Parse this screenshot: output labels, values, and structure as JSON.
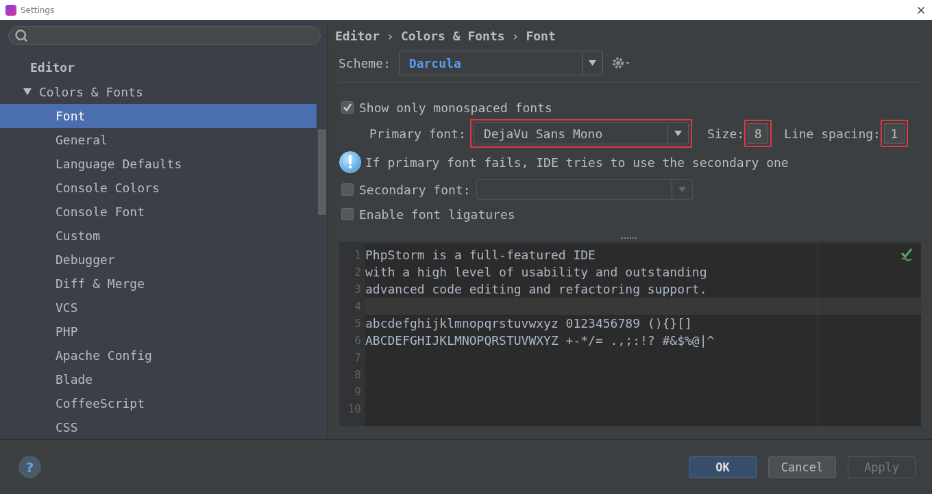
{
  "window": {
    "title": "Settings"
  },
  "sidebar": {
    "section": "Editor",
    "tree": [
      {
        "label": "Colors & Fonts",
        "expanded": true,
        "selected": false,
        "children": [
          {
            "label": "Font",
            "selected": true
          },
          {
            "label": "General",
            "selected": false
          },
          {
            "label": "Language Defaults",
            "selected": false
          },
          {
            "label": "Console Colors",
            "selected": false
          },
          {
            "label": "Console Font",
            "selected": false
          },
          {
            "label": "Custom",
            "selected": false
          },
          {
            "label": "Debugger",
            "selected": false
          },
          {
            "label": "Diff & Merge",
            "selected": false
          },
          {
            "label": "VCS",
            "selected": false
          },
          {
            "label": "PHP",
            "selected": false
          },
          {
            "label": "Apache Config",
            "selected": false
          },
          {
            "label": "Blade",
            "selected": false
          },
          {
            "label": "CoffeeScript",
            "selected": false
          },
          {
            "label": "CSS",
            "selected": false
          }
        ]
      }
    ]
  },
  "breadcrumb": [
    {
      "kind": "crumb",
      "text": "Editor"
    },
    {
      "kind": "separator",
      "text": "›"
    },
    {
      "kind": "crumb",
      "text": "Colors & Fonts"
    },
    {
      "kind": "separator",
      "text": "›"
    },
    {
      "kind": "crumb",
      "text": "Font"
    }
  ],
  "scheme": {
    "label": "Scheme:",
    "value": "Darcula"
  },
  "show_monospaced": {
    "label": "Show only monospaced fonts",
    "checked": true
  },
  "primary_font": {
    "label": "Primary font:",
    "value": "DejaVu Sans Mono",
    "highlighted": true
  },
  "size": {
    "label": "Size:",
    "value": "8",
    "highlighted": true
  },
  "line_spacing": {
    "label": "Line spacing:",
    "value": "1",
    "highlighted": true
  },
  "info": "If primary font fails, IDE tries to use the secondary one",
  "secondary_font": {
    "label": "Secondary font:",
    "checked": false,
    "disabled": true
  },
  "ligatures": {
    "label": "Enable font ligatures",
    "checked": false
  },
  "preview": {
    "lines": [
      {
        "number": "1",
        "kind": "text",
        "text": "PhpStorm is a full-featured IDE"
      },
      {
        "number": "2",
        "kind": "text",
        "text": "with a high level of usability and outstanding"
      },
      {
        "number": "3",
        "kind": "text",
        "text": "advanced code editing and refactoring support."
      },
      {
        "number": "4",
        "kind": "caret_line"
      },
      {
        "number": "5",
        "kind": "text",
        "text": "abcdefghijklmnopqrstuvwxyz 0123456789 (){}[]"
      },
      {
        "number": "6",
        "kind": "text",
        "text": "ABCDEFGHIJKLMNOPQRSTUVWXYZ +-*/= .,;:!? #&$%@|^"
      },
      {
        "number": "7",
        "kind": "text"
      },
      {
        "number": "8",
        "kind": "text"
      },
      {
        "number": "9",
        "kind": "text"
      },
      {
        "number": "10",
        "kind": "text"
      }
    ]
  },
  "help": "?",
  "buttons": [
    {
      "label": "OK",
      "kind": "default"
    },
    {
      "label": "Cancel",
      "kind": "normal"
    },
    {
      "label": "Apply",
      "kind": "disabled"
    }
  ]
}
